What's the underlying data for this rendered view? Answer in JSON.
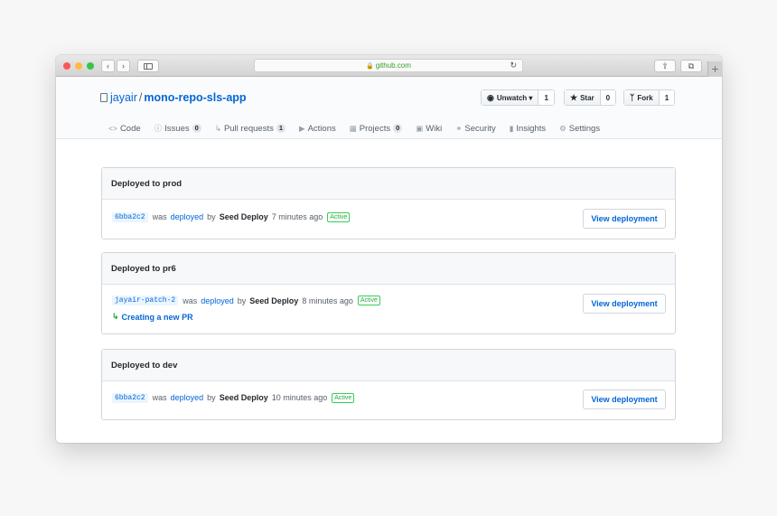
{
  "browser": {
    "url": "github.com",
    "icons": {
      "back": "chevron-left-icon",
      "forward": "chevron-right-icon",
      "sidebar": "sidebar-icon",
      "lock": "lock-icon",
      "reload": "reload-icon",
      "share": "share-icon",
      "tabs": "tabs-overview-icon",
      "new_tab": "plus-icon"
    }
  },
  "repo": {
    "owner": "jayair",
    "separator": "/",
    "name": "mono-repo-sls-app"
  },
  "social": {
    "watch_label": "Unwatch",
    "watch_count": "1",
    "star_label": "Star",
    "star_count": "0",
    "fork_label": "Fork",
    "fork_count": "1"
  },
  "tabs": [
    {
      "label": "Code",
      "count": null,
      "icon": "code-icon"
    },
    {
      "label": "Issues",
      "count": "0",
      "icon": "issue-icon"
    },
    {
      "label": "Pull requests",
      "count": "1",
      "icon": "pull-request-icon"
    },
    {
      "label": "Actions",
      "count": null,
      "icon": "play-icon"
    },
    {
      "label": "Projects",
      "count": "0",
      "icon": "project-icon"
    },
    {
      "label": "Wiki",
      "count": null,
      "icon": "book-icon"
    },
    {
      "label": "Security",
      "count": null,
      "icon": "shield-icon"
    },
    {
      "label": "Insights",
      "count": null,
      "icon": "graph-icon"
    },
    {
      "label": "Settings",
      "count": null,
      "icon": "gear-icon"
    }
  ],
  "deployments": [
    {
      "title": "Deployed to prod",
      "ref": "6bba2c2",
      "was": "was",
      "action": "deployed",
      "by": "by",
      "actor": "Seed Deploy",
      "time": "7 minutes ago",
      "status": "Active",
      "pr": null,
      "button": "View deployment"
    },
    {
      "title": "Deployed to pr6",
      "ref": "jayair-patch-2",
      "was": "was",
      "action": "deployed",
      "by": "by",
      "actor": "Seed Deploy",
      "time": "8 minutes ago",
      "status": "Active",
      "pr": "Creating a new PR",
      "button": "View deployment"
    },
    {
      "title": "Deployed to dev",
      "ref": "6bba2c2",
      "was": "was",
      "action": "deployed",
      "by": "by",
      "actor": "Seed Deploy",
      "time": "10 minutes ago",
      "status": "Active",
      "pr": null,
      "button": "View deployment"
    }
  ],
  "colors": {
    "link": "#0366d6",
    "active": "#28a745",
    "header_bg": "#fafbfc"
  }
}
